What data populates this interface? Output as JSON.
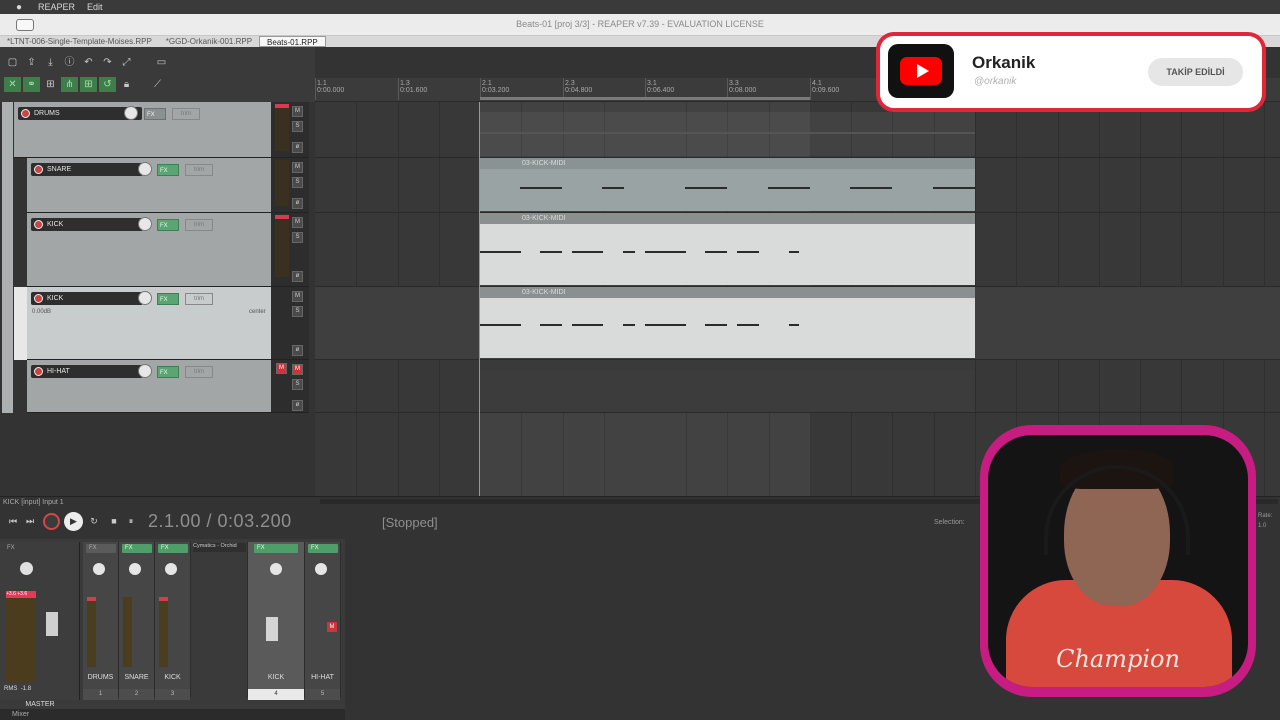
{
  "menubar": {
    "apple": "",
    "app": "REAPER",
    "edit": "Edit"
  },
  "window": {
    "title": "Beats-01 [proj 3/3] - REAPER v7.39 - EVALUATION LICENSE"
  },
  "tabs": [
    "*LTNT-006-Single-Template-Moises.RPP",
    "*GGD-Orkanik-001.RPP",
    "Beats-01.RPP"
  ],
  "ruler": {
    "ticks": [
      {
        "bar": "1.1",
        "time": "0:00.000"
      },
      {
        "bar": "1.3",
        "time": "0:01.600"
      },
      {
        "bar": "2.1",
        "time": "0:03.200"
      },
      {
        "bar": "2.3",
        "time": "0:04.800"
      },
      {
        "bar": "3.1",
        "time": "0:06.400"
      },
      {
        "bar": "3.3",
        "time": "0:08.000"
      },
      {
        "bar": "4.1",
        "time": "0:09.600"
      }
    ]
  },
  "tracks": [
    {
      "num": "1",
      "name": "DRUMS",
      "fx": "FX",
      "trim": "trim"
    },
    {
      "num": "2",
      "name": "SNARE",
      "fx": "FX",
      "trim": "trim"
    },
    {
      "num": "3",
      "name": "KICK",
      "fx": "FX",
      "trim": "trim"
    },
    {
      "num": "4",
      "name": "KICK",
      "fx": "FX",
      "trim": "trim",
      "volume": "0.00dB",
      "pan": "center"
    },
    {
      "num": "5",
      "name": "HI-HAT",
      "fx": "FX",
      "trim": "trim"
    }
  ],
  "items": {
    "kick_midi": "03-KICK-MIDI"
  },
  "msbuttons": {
    "mute": "M",
    "solo": "S",
    "phase": "ø"
  },
  "transport": {
    "input_label": "KICK [input] Input 1",
    "time": "2.1.00 / 0:03.200",
    "status": "[Stopped]",
    "selection_label": "Selection:",
    "rate_label": "Rate:",
    "rate_value": "1.0"
  },
  "mixer": {
    "master": {
      "name": "MASTER",
      "rms_label": "RMS",
      "rms_value": "-1.8",
      "clip": "+3.6  +3.6",
      "fx": "FX"
    },
    "strips": [
      {
        "name": "DRUMS",
        "num": "1",
        "fx": "FX"
      },
      {
        "name": "SNARE",
        "num": "2",
        "fx": "FX"
      },
      {
        "name": "KICK",
        "num": "3",
        "fx": "FX"
      },
      {
        "name": "KICK",
        "num": "4",
        "fx": "FX",
        "plugin": "Cymatics - Orchid"
      },
      {
        "name": "HI-HAT",
        "num": "5",
        "fx": "FX"
      }
    ],
    "tab": "Mixer"
  },
  "youtube": {
    "channel": "Orkanik",
    "handle": "@orkanik",
    "button": "TAKİP EDİLDİ"
  },
  "webcam": {
    "shirt_text": "Champion"
  },
  "colors": {
    "accent_red": "#e0263b",
    "cam_frame": "#c71d83",
    "fx_green": "#5aa573",
    "cursor": "#4cbf9e"
  }
}
